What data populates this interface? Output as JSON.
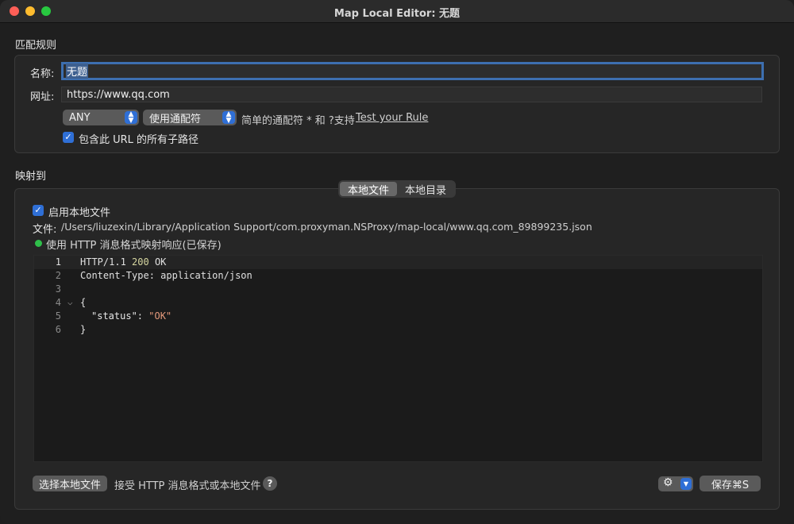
{
  "window": {
    "title": "Map Local Editor: 无题"
  },
  "match_rules": {
    "section_label": "匹配规则",
    "name_label": "名称:",
    "name_value": "无题",
    "url_label": "网址:",
    "url_value": "https://www.qq.com",
    "method_value": "ANY",
    "match_type_value": "使用通配符",
    "hint": "简单的通配符 * 和 ?支持",
    "test_link": "Test your Rule",
    "include_subpaths_label": "包含此 URL 的所有子路径",
    "include_subpaths_checked": true
  },
  "mapping": {
    "section_label": "映射到",
    "tabs": [
      {
        "label": "本地文件",
        "active": true
      },
      {
        "label": "本地目录",
        "active": false
      }
    ],
    "enable_local_file_label": "启用本地文件",
    "enable_local_file_checked": true,
    "file_label": "文件:",
    "file_path": "/Users/liuzexin/Library/Application Support/com.proxyman.NSProxy/map-local/www.qq.com_89899235.json",
    "status_text": "使用 HTTP 消息格式映射响应(已保存)",
    "status_color": "#2fbf4a"
  },
  "editor": {
    "line_numbers": [
      "1",
      "2",
      "3",
      "4",
      "5",
      "6"
    ],
    "lines": {
      "l1_prefix": "HTTP/1.1 ",
      "l1_code": "200",
      "l1_suffix": " OK",
      "l2": "Content-Type: application/json",
      "l4_brace": "{",
      "l5_key": "\"status\"",
      "l5_colon": ": ",
      "l5_value": "\"OK\"",
      "l6_brace": "}"
    }
  },
  "footer": {
    "choose_file_button": "选择本地文件",
    "accept_hint": "接受 HTTP 消息格式或本地文件",
    "help_label": "?",
    "save_button": "保存⌘S"
  },
  "icons": {
    "gear": "gear-icon",
    "chevron": "chevron-down-icon",
    "check": "checkmark-icon"
  },
  "colors": {
    "accent": "#2f6fd6",
    "focus_ring": "#3d6fb0",
    "background": "#1f1f1f"
  }
}
